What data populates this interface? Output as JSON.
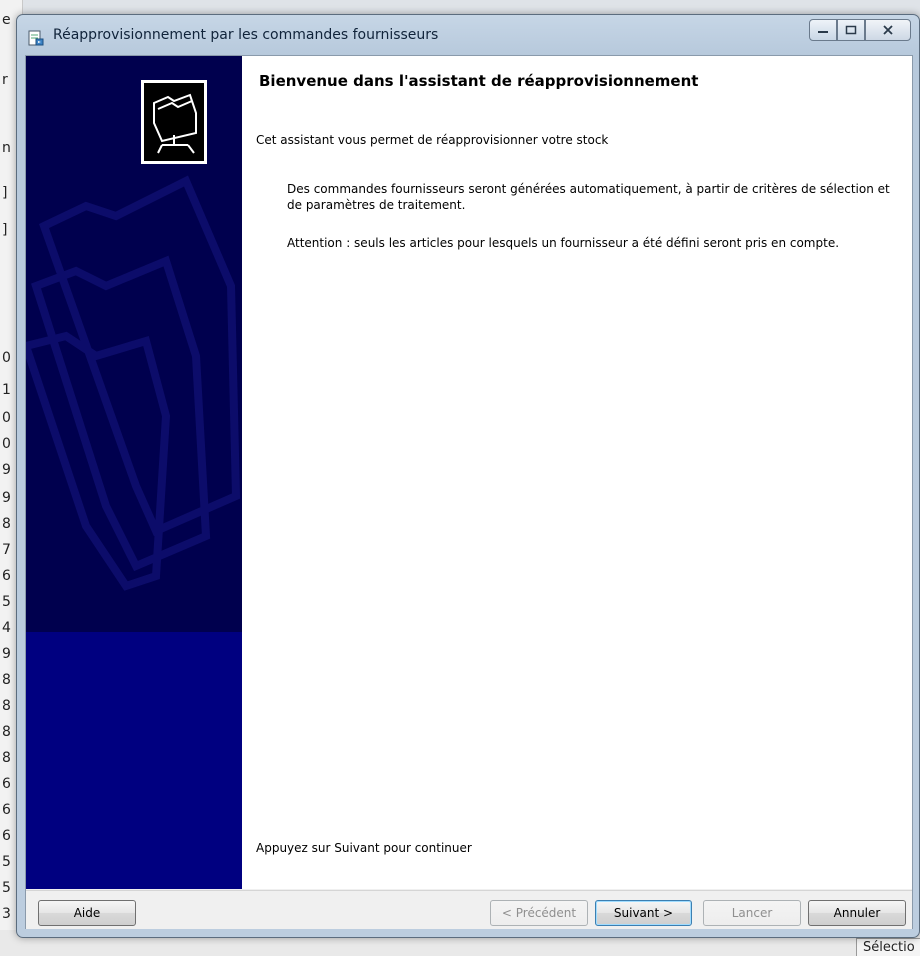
{
  "background": {
    "left_chars": [
      "e",
      "r",
      "n",
      "]",
      "]",
      "0",
      "1",
      "0",
      "0",
      "9",
      "9",
      "8",
      "7",
      "6",
      "5",
      "4",
      "9",
      "8",
      "8",
      "8",
      "8",
      "6",
      "6",
      "6",
      "5",
      "5",
      "3"
    ],
    "bottom_right_text": "Sélectio"
  },
  "window": {
    "title": "Réapprovisionnement par les commandes fournisseurs",
    "controls": {
      "minimize": "minimize",
      "maximize": "maximize",
      "close": "close"
    }
  },
  "wizard": {
    "heading": "Bienvenue dans l'assistant de réapprovisionnement",
    "intro": "Cet assistant vous permet de réapprovisionner votre stock",
    "paragraph1": "Des commandes fournisseurs seront générées automatiquement, à partir de critères de sélection et de paramètres de traitement.",
    "paragraph2": "Attention : seuls les articles pour lesquels un fournisseur a été défini seront pris en compte.",
    "footer_hint": "Appuyez sur Suivant pour continuer"
  },
  "buttons": {
    "help": "Aide",
    "previous": "< Précédent",
    "next": "Suivant >",
    "launch": "Lancer",
    "cancel": "Annuler"
  },
  "colors": {
    "sidebar_dark": "#00004e",
    "sidebar_lower": "#000080",
    "content_bg": "#ffffff"
  },
  "icons": {
    "title_icon": "app-document-icon",
    "wizard_icon": "folder-network-icon"
  }
}
